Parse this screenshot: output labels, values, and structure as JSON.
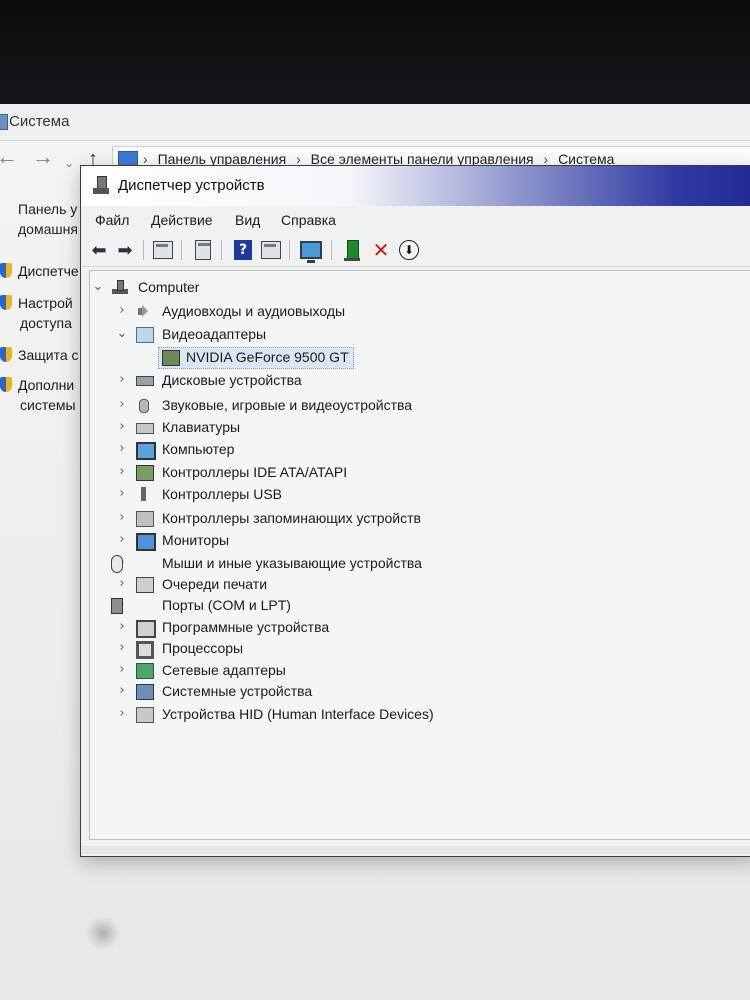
{
  "system_window": {
    "title": "Система",
    "breadcrumbs": [
      "Панель управления",
      "Все элементы панели управления",
      "Система"
    ],
    "sidebar": {
      "heading_line1": "Панель у",
      "heading_line2": "домашня",
      "links": [
        {
          "line1": "Диспетче",
          "line2": ""
        },
        {
          "line1": "Настрой",
          "line2": "доступа"
        },
        {
          "line1": "Защита с",
          "line2": ""
        },
        {
          "line1": "Дополни",
          "line2": "системы"
        }
      ]
    }
  },
  "device_manager": {
    "title": "Диспетчер устройств",
    "menu": [
      "Файл",
      "Действие",
      "Вид",
      "Справка"
    ],
    "toolbar_icons": [
      "back-arrow-icon",
      "forward-arrow-icon",
      "properties-icon",
      "properties-view-icon",
      "help-icon",
      "action-view-icon",
      "scan-hardware-icon",
      "update-driver-icon",
      "uninstall-icon",
      "download-driver-icon"
    ],
    "tree": {
      "root": "Computer",
      "categories": [
        {
          "label": "Аудиовходы и аудиовыходы",
          "expanded": false,
          "icon": "speaker-icon"
        },
        {
          "label": "Видеоадаптеры",
          "expanded": true,
          "icon": "display-adapter-icon",
          "children": [
            "NVIDIA GeForce 9500 GT"
          ]
        },
        {
          "label": "Дисковые устройства",
          "expanded": false,
          "icon": "disk-icon"
        },
        {
          "label": "Звуковые, игровые и видеоустройства",
          "expanded": false,
          "icon": "sound-icon"
        },
        {
          "label": "Клавиатуры",
          "expanded": false,
          "icon": "keyboard-icon"
        },
        {
          "label": "Компьютер",
          "expanded": false,
          "icon": "computer-icon"
        },
        {
          "label": "Контроллеры IDE ATA/ATAPI",
          "expanded": false,
          "icon": "ide-controller-icon"
        },
        {
          "label": "Контроллеры USB",
          "expanded": false,
          "icon": "usb-icon"
        },
        {
          "label": "Контроллеры запоминающих устройств",
          "expanded": false,
          "icon": "storage-controller-icon"
        },
        {
          "label": "Мониторы",
          "expanded": false,
          "icon": "monitor-icon"
        },
        {
          "label": "Мыши и иные указывающие устройства",
          "expanded": false,
          "icon": "mouse-icon"
        },
        {
          "label": "Очереди печати",
          "expanded": false,
          "icon": "printer-icon"
        },
        {
          "label": "Порты (COM и LPT)",
          "expanded": false,
          "icon": "port-icon"
        },
        {
          "label": "Программные устройства",
          "expanded": false,
          "icon": "software-device-icon"
        },
        {
          "label": "Процессоры",
          "expanded": false,
          "icon": "processor-icon"
        },
        {
          "label": "Сетевые адаптеры",
          "expanded": false,
          "icon": "network-adapter-icon"
        },
        {
          "label": "Системные устройства",
          "expanded": false,
          "icon": "system-device-icon"
        },
        {
          "label": "Устройства HID (Human Interface Devices)",
          "expanded": false,
          "icon": "hid-icon"
        }
      ]
    }
  }
}
